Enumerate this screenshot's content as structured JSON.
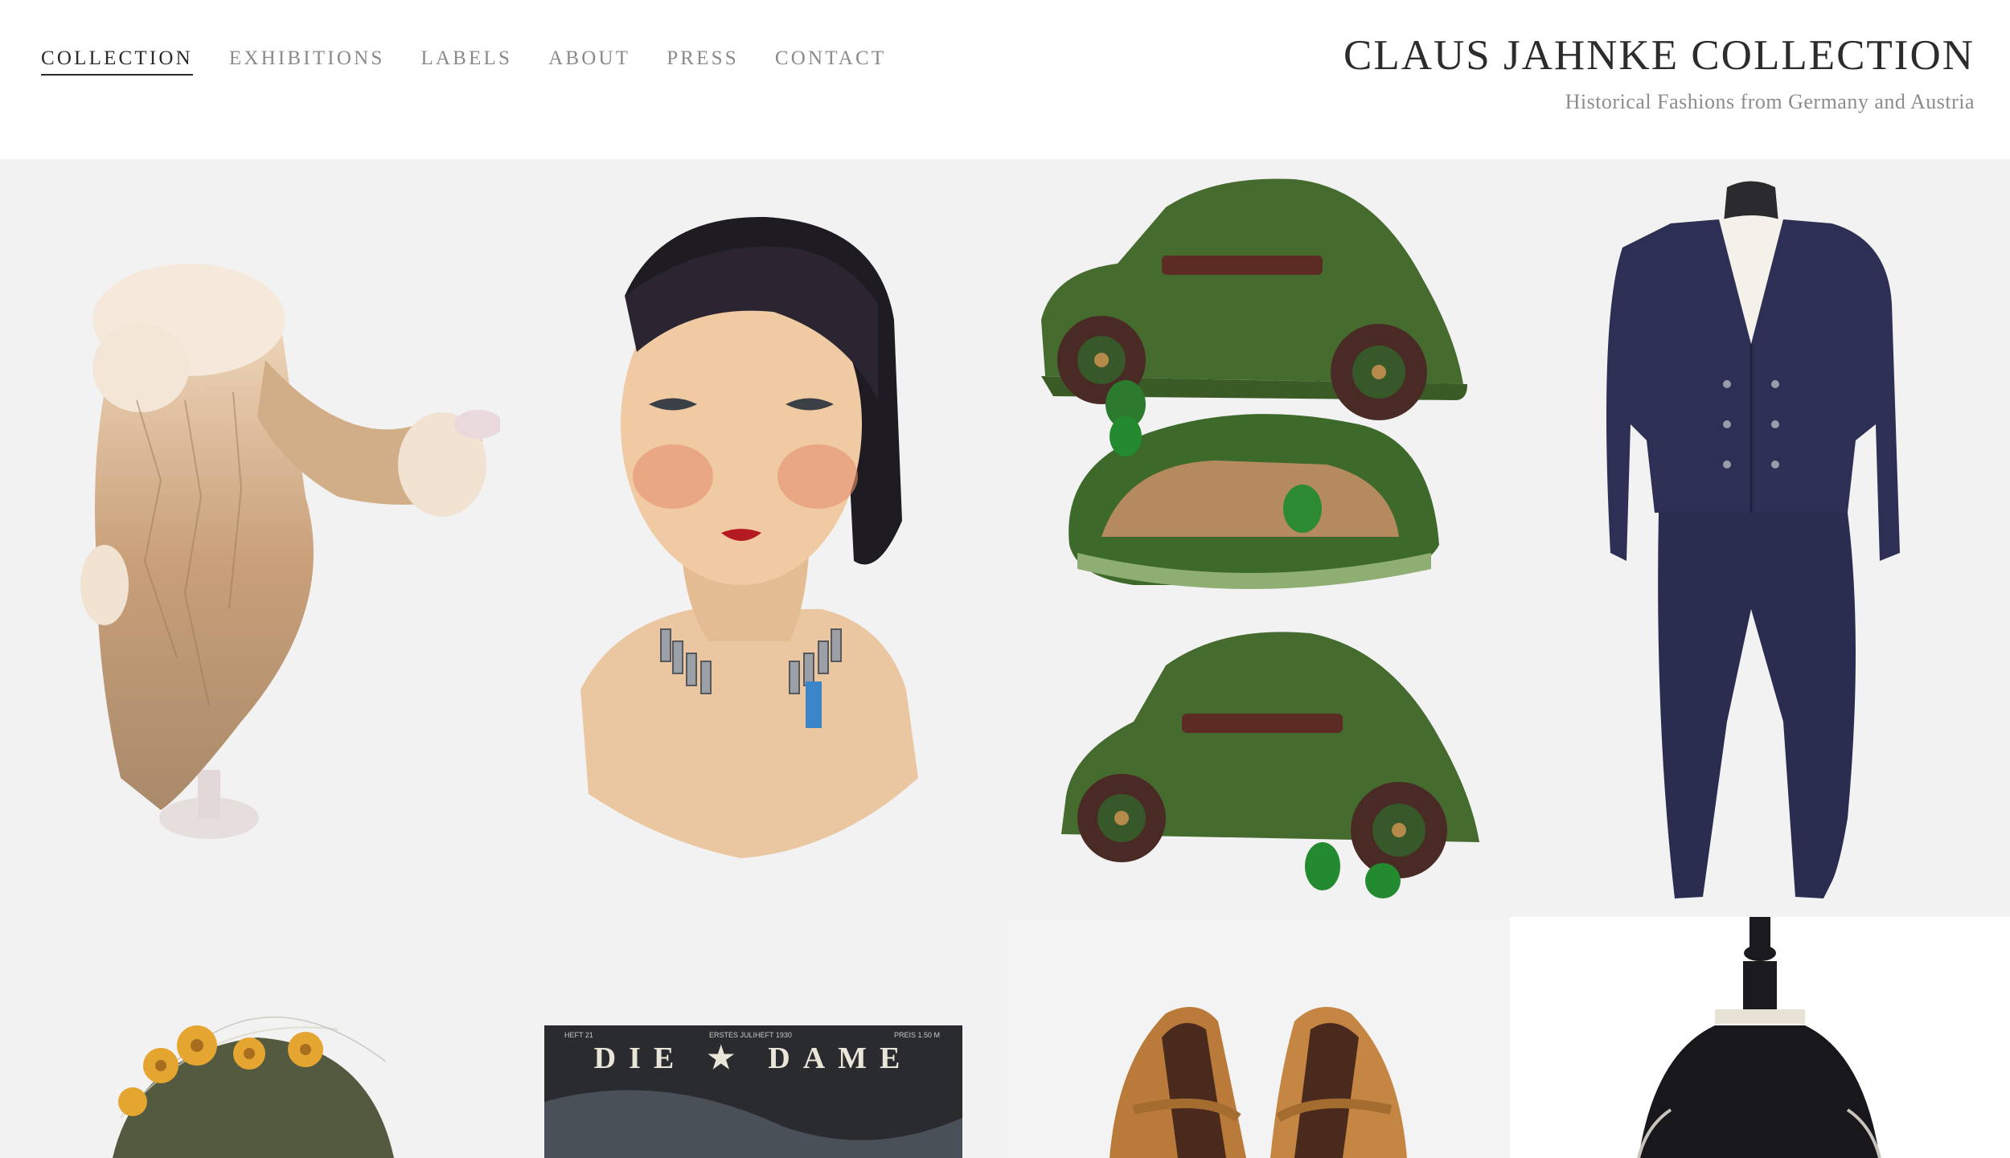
{
  "nav": {
    "items": [
      {
        "label": "COLLECTION",
        "active": true
      },
      {
        "label": "EXHIBITIONS",
        "active": false
      },
      {
        "label": "LABELS",
        "active": false
      },
      {
        "label": "ABOUT",
        "active": false
      },
      {
        "label": "PRESS",
        "active": false
      },
      {
        "label": "CONTACT",
        "active": false
      }
    ]
  },
  "brand": {
    "title": "CLAUS JAHNKE COLLECTION",
    "subtitle": "Historical Fashions from Germany and Austria"
  },
  "collection": {
    "items": [
      {
        "icon": "fur-trimmed-coat-image"
      },
      {
        "icon": "mannequin-head-image"
      },
      {
        "icon": "car-shaped-handbag-image"
      },
      {
        "icon": "navy-suit-image"
      },
      {
        "icon": "floral-hat-image"
      },
      {
        "icon": "magazine-cover-image",
        "cover_text": "DIE ★ DAME",
        "issue_left": "HEFT 21",
        "issue_center": "ERSTES JULIHEFT 1930",
        "issue_right": "PREIS 1.50 M"
      },
      {
        "icon": "leather-shoes-image"
      },
      {
        "icon": "dress-form-image"
      }
    ]
  },
  "colors": {
    "tile_bg": "#f2f2f3",
    "nav_active": "#2a2a2a",
    "nav_inactive": "#8a8a8a"
  }
}
